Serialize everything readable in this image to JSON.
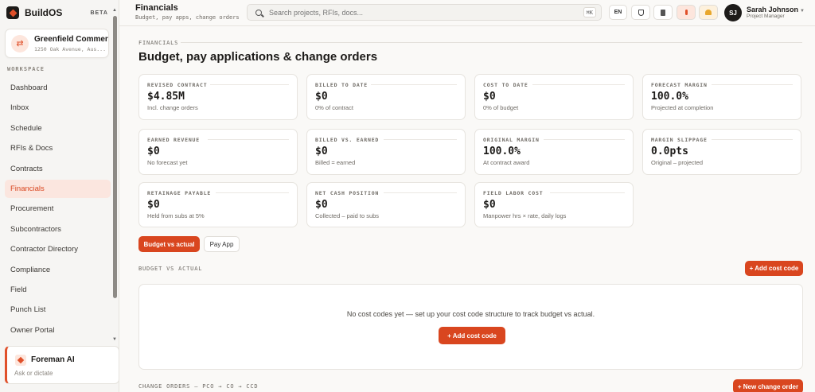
{
  "app": {
    "name": "BuildOS",
    "badge": "BETA"
  },
  "project": {
    "name": "Greenfield Commer...",
    "address": "1250 Oak Avenue, Aus..."
  },
  "sidebar": {
    "section_label": "WORKSPACE",
    "items": [
      {
        "label": "Dashboard",
        "active": false
      },
      {
        "label": "Inbox",
        "active": false
      },
      {
        "label": "Schedule",
        "active": false
      },
      {
        "label": "RFIs & Docs",
        "active": false
      },
      {
        "label": "Contracts",
        "active": false
      },
      {
        "label": "Financials",
        "active": true
      },
      {
        "label": "Procurement",
        "active": false
      },
      {
        "label": "Subcontractors",
        "active": false
      },
      {
        "label": "Contractor Directory",
        "active": false
      },
      {
        "label": "Compliance",
        "active": false
      },
      {
        "label": "Field",
        "active": false
      },
      {
        "label": "Punch List",
        "active": false
      },
      {
        "label": "Owner Portal",
        "active": false
      }
    ],
    "ai": {
      "title": "Foreman AI",
      "subtitle": "Ask or dictate"
    }
  },
  "header": {
    "title": "Financials",
    "subtitle": "Budget, pay apps, change orders",
    "search_placeholder": "Search projects, RFIs, docs...",
    "shortcut": "⌘K",
    "language": "EN",
    "icons": [
      "shield-icon",
      "document-icon",
      "alert-icon",
      "bell-icon"
    ],
    "user": {
      "initials": "SJ",
      "name": "Sarah Johnson",
      "role": "Project Manager"
    }
  },
  "main": {
    "eyebrow": "FINANCIALS",
    "heading": "Budget, pay applications & change orders",
    "cards": [
      {
        "label": "REVISED CONTRACT",
        "value": "$4.85M",
        "sub": "Incl. change orders"
      },
      {
        "label": "BILLED TO DATE",
        "value": "$0",
        "sub": "0% of contract"
      },
      {
        "label": "COST TO DATE",
        "value": "$0",
        "sub": "0% of budget"
      },
      {
        "label": "FORECAST MARGIN",
        "value": "100.0%",
        "sub": "Projected at completion"
      },
      {
        "label": "EARNED REVENUE",
        "value": "$0",
        "sub": "No forecast yet"
      },
      {
        "label": "BILLED VS. EARNED",
        "value": "$0",
        "sub": "Billed = earned"
      },
      {
        "label": "ORIGINAL MARGIN",
        "value": "100.0%",
        "sub": "At contract award"
      },
      {
        "label": "MARGIN SLIPPAGE",
        "value": "0.0pts",
        "sub": "Original – projected"
      },
      {
        "label": "RETAINAGE PAYABLE",
        "value": "$0",
        "sub": "Held from subs at 5%"
      },
      {
        "label": "NET CASH POSITION",
        "value": "$0",
        "sub": "Collected – paid to subs"
      },
      {
        "label": "FIELD LABOR COST",
        "value": "$0",
        "sub": "Manpower hrs × rate, daily logs"
      }
    ],
    "tabs": [
      {
        "label": "Budget vs actual",
        "active": true
      },
      {
        "label": "Pay App",
        "active": false
      }
    ],
    "bva": {
      "label": "BUDGET VS ACTUAL",
      "add_button": "+ Add cost code",
      "empty_text": "No cost codes yet — set up your cost code structure to track budget vs actual.",
      "empty_button": "+ Add cost code"
    },
    "change_orders": {
      "label": "CHANGE ORDERS — PCO → CO → CCD",
      "new_button": "+ New change order"
    }
  },
  "colors": {
    "accent": "#d9461f",
    "accent_soft": "#fbe6df",
    "background": "#faf9f7"
  }
}
